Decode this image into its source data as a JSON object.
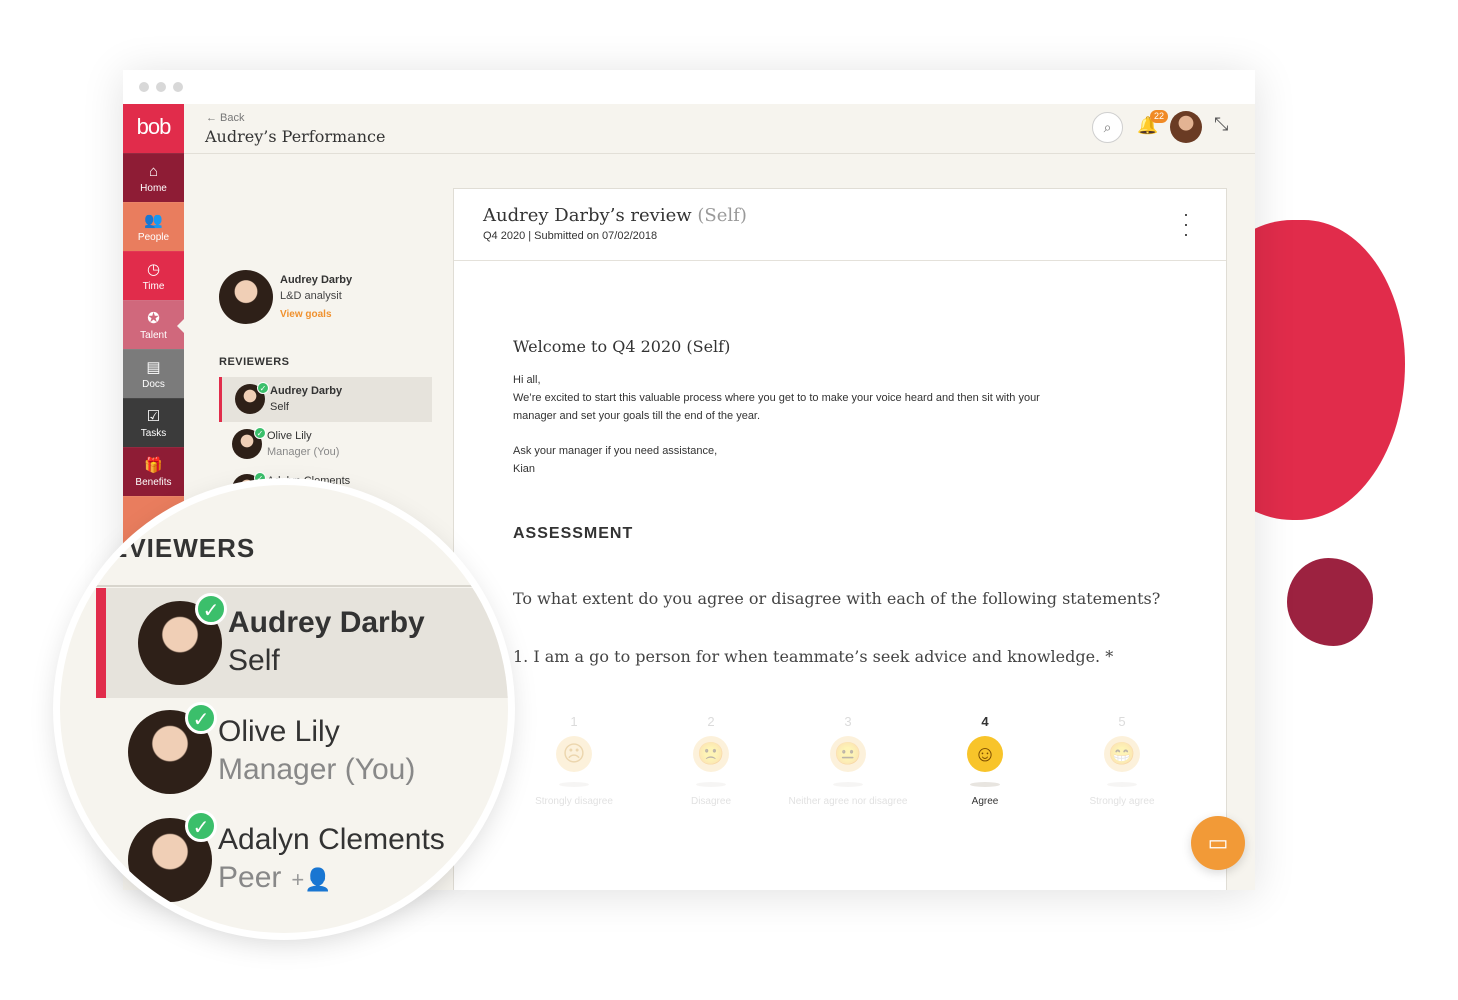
{
  "app": {
    "logo": "bob"
  },
  "nav": [
    {
      "label": "Home",
      "icon": "home-icon",
      "glyph": "⌂"
    },
    {
      "label": "People",
      "icon": "people-icon",
      "glyph": "👥"
    },
    {
      "label": "Time",
      "icon": "clock-icon",
      "glyph": "◷"
    },
    {
      "label": "Talent",
      "icon": "talent-icon",
      "glyph": "✪"
    },
    {
      "label": "Docs",
      "icon": "docs-icon",
      "glyph": "▤"
    },
    {
      "label": "Tasks",
      "icon": "tasks-icon",
      "glyph": "☑"
    },
    {
      "label": "Benefits",
      "icon": "gift-icon",
      "glyph": "🎁"
    }
  ],
  "header": {
    "back_label": "← Back",
    "title": "Audrey’s Performance",
    "notification_count": "22"
  },
  "profile": {
    "name": "Audrey Darby",
    "role": "L&D analysit",
    "goals_link": "View goals"
  },
  "reviewers": {
    "heading": "REVIEWERS",
    "items": [
      {
        "name": "Audrey Darby",
        "role": "Self",
        "active": true
      },
      {
        "name": "Olive Lily",
        "role": "Manager (You)",
        "active": false
      },
      {
        "name": "Adalyn Clements",
        "role": "Peer",
        "active": false
      }
    ]
  },
  "zoom": {
    "heading": "EVIEWERS"
  },
  "review": {
    "title": "Audrey Darby’s review",
    "title_suffix": "(Self)",
    "subtitle": "Q4 2020 | Submitted on 07/02/2018",
    "welcome": "Welcome to Q4 2020 (Self)",
    "greeting": "Hi all,",
    "line1": "We’re excited to start this valuable process where you get to to make your voice heard and then sit with your",
    "line2": "manager and set your goals till the end of the year.",
    "line3": "Ask your manager if you need assistance,",
    "line4": "Kian",
    "assessment_heading": "ASSESSMENT",
    "question": "To what extent do you agree or disagree with each of the following statements?",
    "statement": "1. I am a go to person for when teammate’s seek advice and knowledge. *"
  },
  "scale": {
    "selected": 4,
    "options": [
      {
        "num": "1",
        "label": "Strongly disagree",
        "face": "☹"
      },
      {
        "num": "2",
        "label": "Disagree",
        "face": "🙁"
      },
      {
        "num": "3",
        "label": "Neither agree nor disagree",
        "face": "😐"
      },
      {
        "num": "4",
        "label": "Agree",
        "face": "☺"
      },
      {
        "num": "5",
        "label": "Strongly agree",
        "face": "😁"
      }
    ]
  },
  "colors": {
    "brand": "#e12c4b",
    "accent": "#f29a37",
    "check": "#3bbf6b"
  }
}
